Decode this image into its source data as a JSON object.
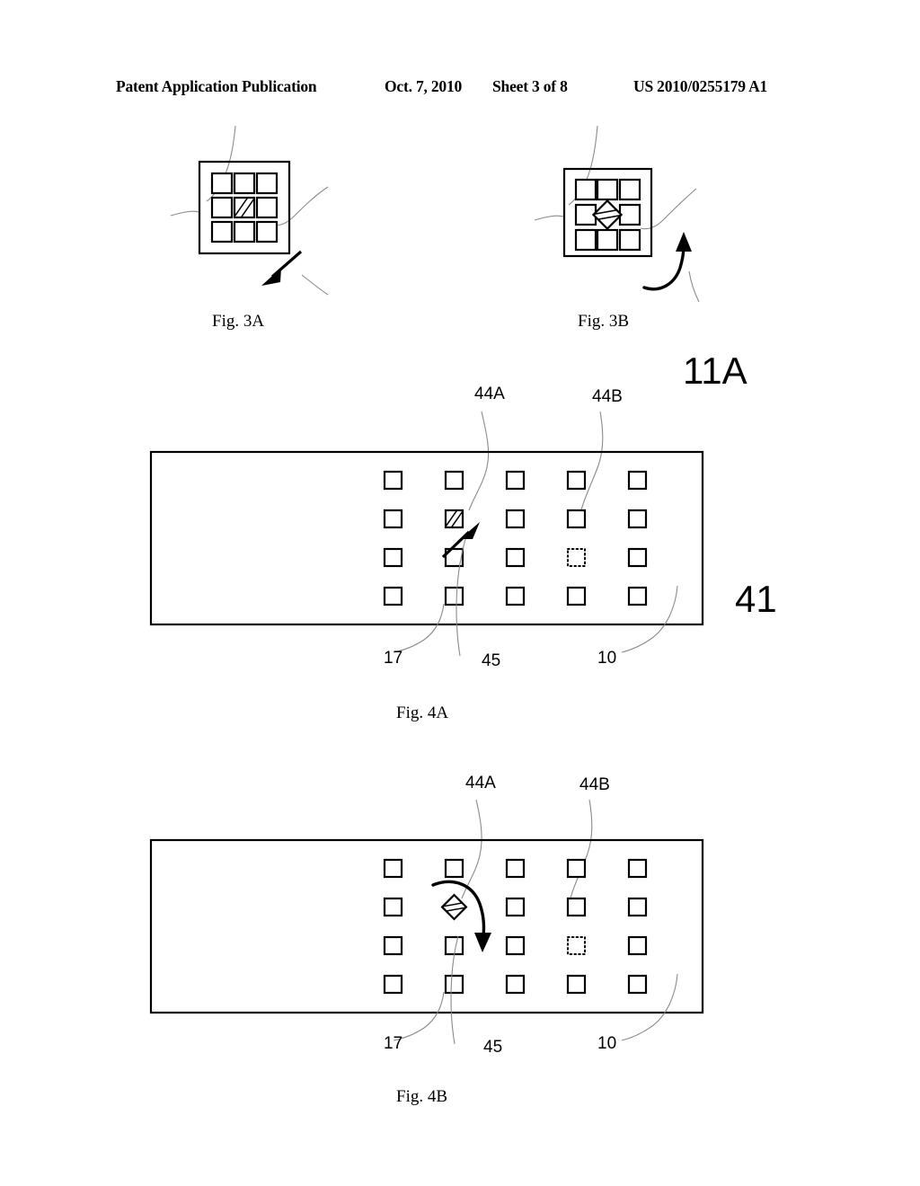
{
  "header": {
    "publication": "Patent Application Publication",
    "date": "Oct. 7, 2010",
    "sheet": "Sheet 3 of 8",
    "patent_number": "US 2010/0255179 A1"
  },
  "figures": {
    "fig3a": {
      "caption": "Fig. 3A",
      "grid": {
        "rows": 3,
        "cols": 3
      },
      "highlight_cell": {
        "row": 2,
        "col": 2,
        "style": "hatched-square"
      },
      "arrow": "straight-down-left"
    },
    "fig3b": {
      "caption": "Fig. 3B",
      "grid": {
        "rows": 3,
        "cols": 3
      },
      "highlight_cell": {
        "row": 2,
        "col": 2,
        "style": "hatched-diamond"
      },
      "arrow": "curved-up"
    },
    "fig4a": {
      "caption": "Fig. 4A",
      "grid": {
        "rows": 4,
        "cols": 5
      },
      "highlight_cell": {
        "row": 2,
        "col": 2,
        "style": "hatched-square"
      },
      "dotted_cell": {
        "row": 3,
        "col": 4
      },
      "arrow": "straight-up-right",
      "labels": {
        "top_left": "44A",
        "top_right": "44B",
        "bottom_left": "17",
        "bottom_center": "45",
        "bottom_right": "10",
        "side": "41"
      }
    },
    "fig4b": {
      "caption": "Fig. 4B",
      "grid": {
        "rows": 4,
        "cols": 5
      },
      "highlight_cell": {
        "row": 2,
        "col": 2,
        "style": "hatched-diamond"
      },
      "dotted_cell": {
        "row": 3,
        "col": 4
      },
      "arrow": "curved-down",
      "labels": {
        "top_left": "44A",
        "top_right": "44B",
        "bottom_left": "17",
        "bottom_center": "45",
        "bottom_right": "10"
      }
    }
  },
  "sheet_label": "11A"
}
